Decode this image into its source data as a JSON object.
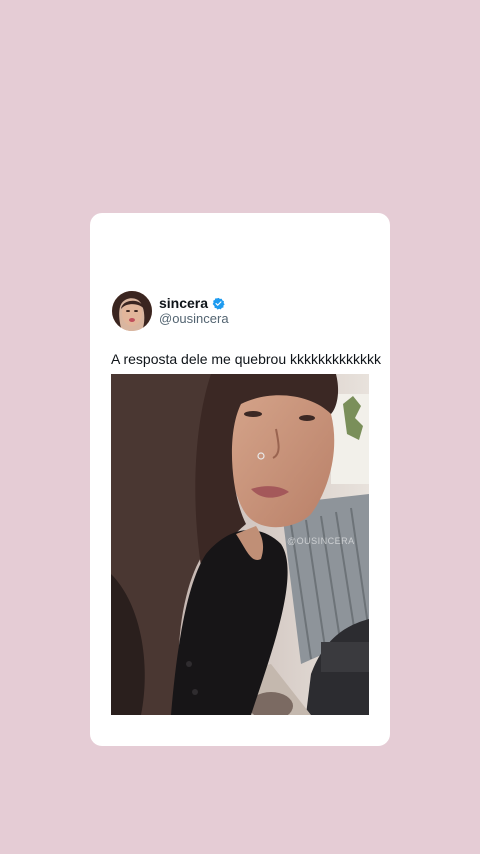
{
  "post": {
    "display_name": "sincera",
    "handle": "@ousincera",
    "text": "A resposta dele me quebrou kkkkkkkkkkkkk",
    "verified_color": "#1d9bf0"
  },
  "media": {
    "watermark": "@OUSINCERA"
  },
  "colors": {
    "background": "#e5ccd5",
    "card": "#ffffff"
  }
}
